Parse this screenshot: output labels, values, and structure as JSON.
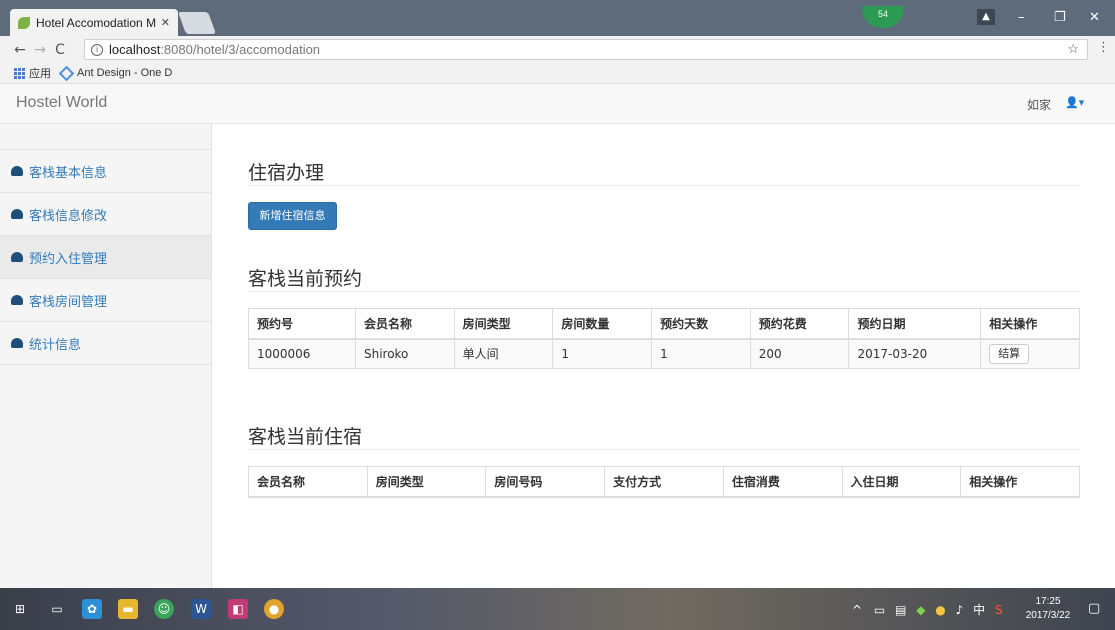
{
  "browser": {
    "tab_title": "Hotel Accomodation M",
    "tab_close": "✕",
    "url_host": "localhost",
    "url_path": ":8080/hotel/3/accomodation",
    "badge": "54",
    "bookmarks": [
      {
        "label": "应用",
        "icon": "apps-icon"
      },
      {
        "label": "Ant Design - One D",
        "icon": "ant-design-icon"
      }
    ]
  },
  "navbar": {
    "brand": "Hostel World",
    "user_name": "如家",
    "user_icon": "👤▾"
  },
  "sidebar": {
    "items": [
      {
        "label": "客栈基本信息",
        "active": false
      },
      {
        "label": "客栈信息修改",
        "active": false
      },
      {
        "label": "预约入住管理",
        "active": true
      },
      {
        "label": "客栈房间管理",
        "active": false
      },
      {
        "label": "统计信息",
        "active": false
      }
    ]
  },
  "main": {
    "title": "住宿办理",
    "add_button": "新增住宿信息",
    "reservations": {
      "title": "客栈当前预约",
      "columns": [
        "预约号",
        "会员名称",
        "房间类型",
        "房间数量",
        "预约天数",
        "预约花费",
        "预约日期",
        "相关操作"
      ],
      "rows": [
        [
          "1000006",
          "Shiroko",
          "单人间",
          "1",
          "1",
          "200",
          "2017-03-20",
          "结算"
        ]
      ]
    },
    "stays": {
      "title": "客栈当前住宿",
      "columns": [
        "会员名称",
        "房间类型",
        "房间号码",
        "支付方式",
        "住宿消费",
        "入住日期",
        "相关操作"
      ],
      "rows": []
    }
  },
  "taskbar": {
    "time": "17:25",
    "date": "2017/3/22",
    "ime": "中"
  },
  "colors": {
    "primary": "#337ab7",
    "tabbar": "#5e6b7a"
  }
}
